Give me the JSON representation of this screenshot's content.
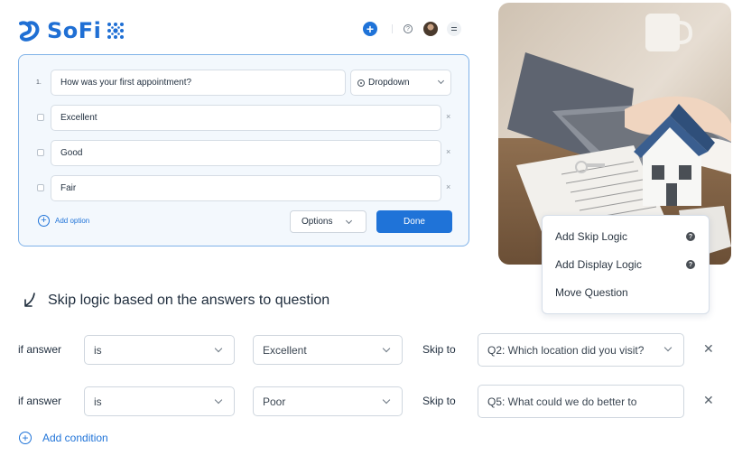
{
  "brand": {
    "name": "SoFi"
  },
  "header": {
    "icons": [
      "plus-circle-icon",
      "help-icon",
      "user-avatar",
      "menu-icon"
    ],
    "accent_color": "#1f73d8"
  },
  "question": {
    "number": "1.",
    "text": "How was your first appointment?",
    "type": "Dropdown",
    "options": [
      "Excellent",
      "Good",
      "Fair"
    ],
    "add_option_label": "Add option",
    "options_button_label": "Options",
    "done_button_label": "Done"
  },
  "context_menu": {
    "items": [
      "Add Skip Logic",
      "Add Display Logic",
      "Move Question"
    ]
  },
  "skip_logic": {
    "title": "Skip logic based on the answers to question",
    "rules": [
      {
        "if_label": "if answer",
        "operator": "is",
        "answer": "Excellent",
        "skip_label": "Skip to",
        "target": "Q2: Which location did you visit?"
      },
      {
        "if_label": "if answer",
        "operator": "is",
        "answer": "Poor",
        "skip_label": "Skip to",
        "target": "Q5: What could we do better to"
      }
    ],
    "add_condition_label": "Add condition"
  }
}
